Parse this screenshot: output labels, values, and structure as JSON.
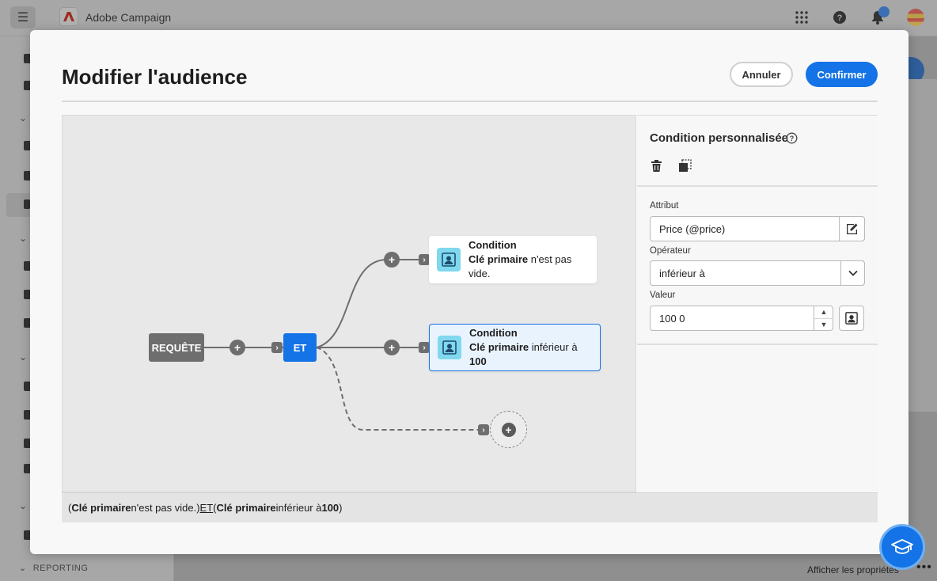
{
  "app": {
    "name": "Adobe Campaign",
    "brand_color": "#eb1000",
    "menu_icon": "hamburger-icon",
    "top_icons": [
      "apps-grid-icon",
      "help-icon",
      "bell-icon",
      "avatar"
    ]
  },
  "leftnav": {
    "reporting_label": "REPORTING"
  },
  "background": {
    "properties_link": "Afficher les propriétés",
    "more_icon": "more-icon"
  },
  "modal": {
    "title": "Modifier l'audience",
    "cancel_label": "Annuler",
    "confirm_label": "Confirmer",
    "accent": "#1473e6"
  },
  "canvas": {
    "query_label": "REQUÊTE",
    "and_label": "ET",
    "conditions": [
      {
        "title": "Condition",
        "attribute": "Clé primaire",
        "rest": " n'est pas vide.",
        "selected": false
      },
      {
        "title": "Condition",
        "attribute": "Clé primaire",
        "operator": " inférieur à ",
        "value": "100",
        "selected": true
      }
    ]
  },
  "summary": {
    "open1": "(",
    "attr1": "Clé primaire",
    "rest1": " n'est pas vide.) ",
    "and": "ET",
    "open2": " (",
    "attr2": "Clé primaire",
    "op2": " inférieur à ",
    "val2": "100",
    "close2": ")"
  },
  "properties": {
    "title": "Condition personnalisée",
    "attribute_label": "Attribut",
    "attribute_value": "Price (@price)",
    "operator_label": "Opérateur",
    "operator_value": "inférieur à",
    "value_label": "Valeur",
    "value_value": "100 0"
  }
}
